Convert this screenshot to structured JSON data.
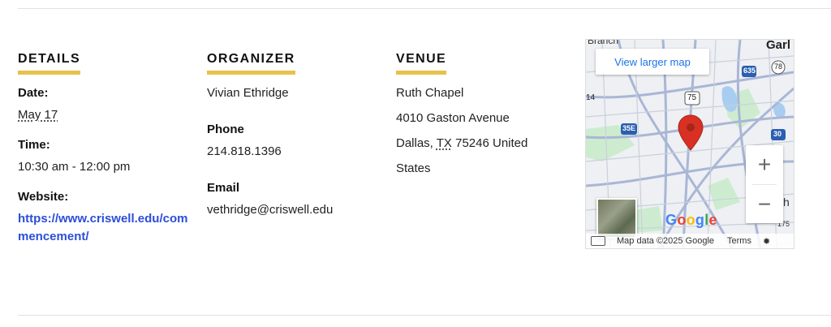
{
  "details": {
    "heading": "DETAILS",
    "date_label": "Date:",
    "date_value": "May 17",
    "time_label": "Time:",
    "time_value": "10:30 am - 12:00 pm",
    "website_label": "Website:",
    "website_value": "https://www.criswell.edu/commencement/"
  },
  "organizer": {
    "heading": "ORGANIZER",
    "name": "Vivian Ethridge",
    "phone_label": "Phone",
    "phone_value": "214.818.1396",
    "email_label": "Email",
    "email_value": "vethridge@criswell.edu"
  },
  "venue": {
    "heading": "VENUE",
    "name": "Ruth Chapel",
    "street": "4010 Gaston Avenue",
    "city": "Dallas,",
    "state": "TX",
    "zip_country": "75246 United",
    "country_rest": "States"
  },
  "map": {
    "larger_map_label": "View larger map",
    "zoom_in": "+",
    "zoom_out": "−",
    "attribution": "Map data ©2025 Google",
    "terms": "Terms",
    "labels": [
      "Branch",
      "Garl",
      "635",
      "78",
      "75",
      "35E",
      "30",
      "14",
      "h",
      "175"
    ],
    "google_logo": "Google",
    "accent": "#1a73e8",
    "pin_color": "#d93025"
  },
  "colors": {
    "underline": "#e8c14a",
    "link": "#2b4ed8"
  }
}
